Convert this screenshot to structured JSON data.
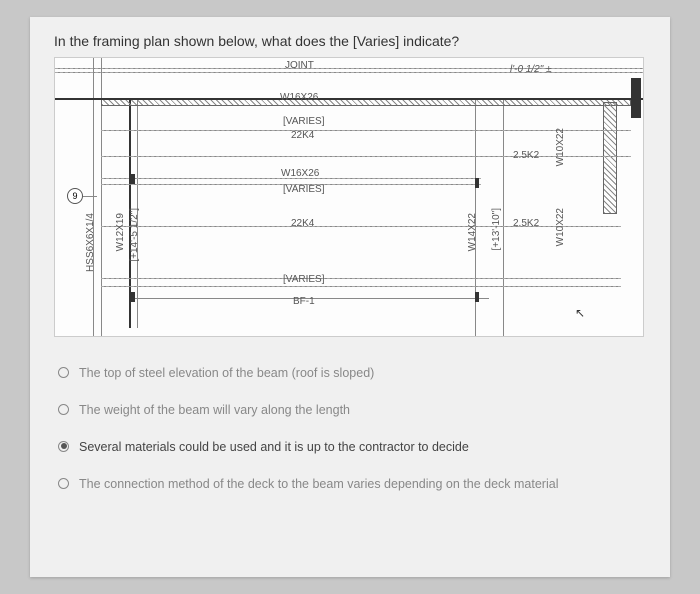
{
  "question": "In the framing plan shown below, what does the [Varies] indicate?",
  "diagram_labels": {
    "joint": "JOINT",
    "dim_top": "l'-0 1/2\" ±",
    "w16x26_a": "W16X26",
    "varies_a": "[VARIES]",
    "k22k4_a": "22K4",
    "k25k2_a": "2.5K2",
    "w16x26_b": "W16X26",
    "varies_b": "[VARIES]",
    "k22k4_b": "22K4",
    "k25k2_b": "2.5K2",
    "varies_c": "[VARIES]",
    "bf1": "BF-1",
    "hss": "HSS6X6X1/4",
    "w12x19": "W12X19",
    "w12x19_off": "[+14'-5 1/2\"]",
    "w14x22": "W14X22",
    "w14x22_off": "[+13'-10\"]",
    "w10x22_a": "W10X22",
    "w10x22_b": "W10X22",
    "grid_num": "9"
  },
  "options": [
    {
      "text": "The top of steel elevation of the beam (roof is sloped)",
      "selected": false
    },
    {
      "text": "The weight of the beam will vary along the length",
      "selected": false
    },
    {
      "text": "Several materials could be used and it is up to the contractor to decide",
      "selected": true
    },
    {
      "text": "The connection method of the deck to the beam varies depending on the deck material",
      "selected": false
    }
  ]
}
